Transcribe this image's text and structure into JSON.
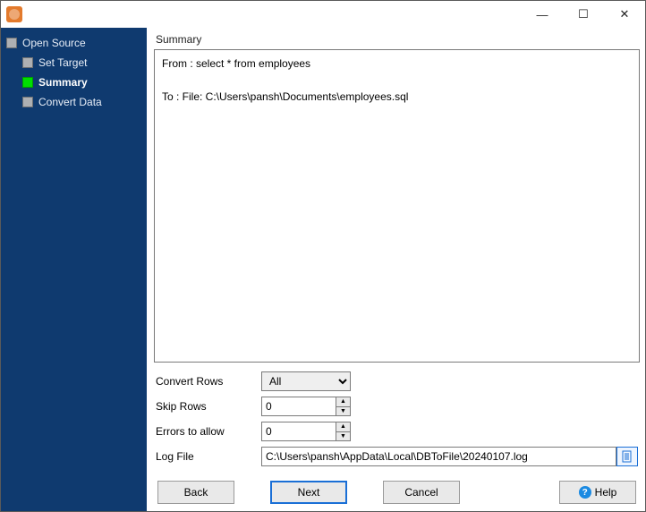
{
  "window": {
    "controls": {
      "minimize": "—",
      "maximize": "☐",
      "close": "✕"
    }
  },
  "sidebar": {
    "items": [
      {
        "label": "Open Source",
        "active": false
      },
      {
        "label": "Set Target",
        "active": false
      },
      {
        "label": "Summary",
        "active": true
      },
      {
        "label": "Convert Data",
        "active": false
      }
    ]
  },
  "summary": {
    "section_label": "Summary",
    "from_line": "From : select * from employees",
    "to_line": "To : File: C:\\Users\\pansh\\Documents\\employees.sql"
  },
  "form": {
    "convert_rows": {
      "label": "Convert Rows",
      "value": "All"
    },
    "skip_rows": {
      "label": "Skip Rows",
      "value": "0"
    },
    "errors_allow": {
      "label": "Errors to allow",
      "value": "0"
    },
    "log_file": {
      "label": "Log File",
      "value": "C:\\Users\\pansh\\AppData\\Local\\DBToFile\\20240107.log"
    }
  },
  "buttons": {
    "back": "Back",
    "next": "Next",
    "cancel": "Cancel",
    "help": "Help"
  }
}
